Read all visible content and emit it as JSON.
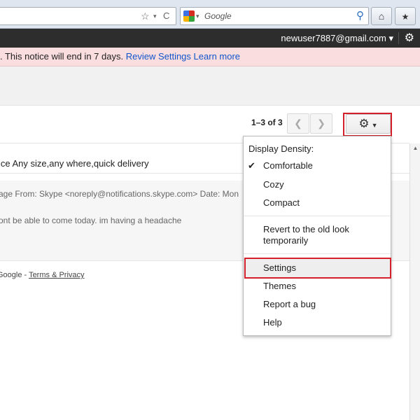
{
  "browser": {
    "search_placeholder": "Google",
    "star_icon": "☆",
    "reload_icon": "C",
    "home_icon": "⌂",
    "bookmark_icon": "★"
  },
  "gbar": {
    "account": "newuser7887@gmail.com ▾"
  },
  "notice": {
    "text": ". This notice will end in 7 days.",
    "review_link": "Review Settings",
    "learn_link": "Learn more"
  },
  "toolbar": {
    "pager": "1–3 of 3"
  },
  "messages": [
    {
      "text": "ice Any size,any where,quick delivery"
    },
    {
      "text": "age From: Skype <noreply@notifications.skype.com> Date: Mon"
    },
    {
      "text": "ont be able to come today. im having a headache"
    }
  ],
  "footer": {
    "prefix": "Google - ",
    "terms_link": "Terms & Privacy"
  },
  "menu": {
    "density_label": "Display Density:",
    "comfortable": "Comfortable",
    "cozy": "Cozy",
    "compact": "Compact",
    "revert": "Revert to the old look temporarily",
    "settings": "Settings",
    "themes": "Themes",
    "report_bug": "Report a bug",
    "help": "Help"
  },
  "colors": {
    "highlight_red": "#d3202b",
    "link_blue": "#1155cc",
    "notice_bg": "#f9dddf"
  }
}
